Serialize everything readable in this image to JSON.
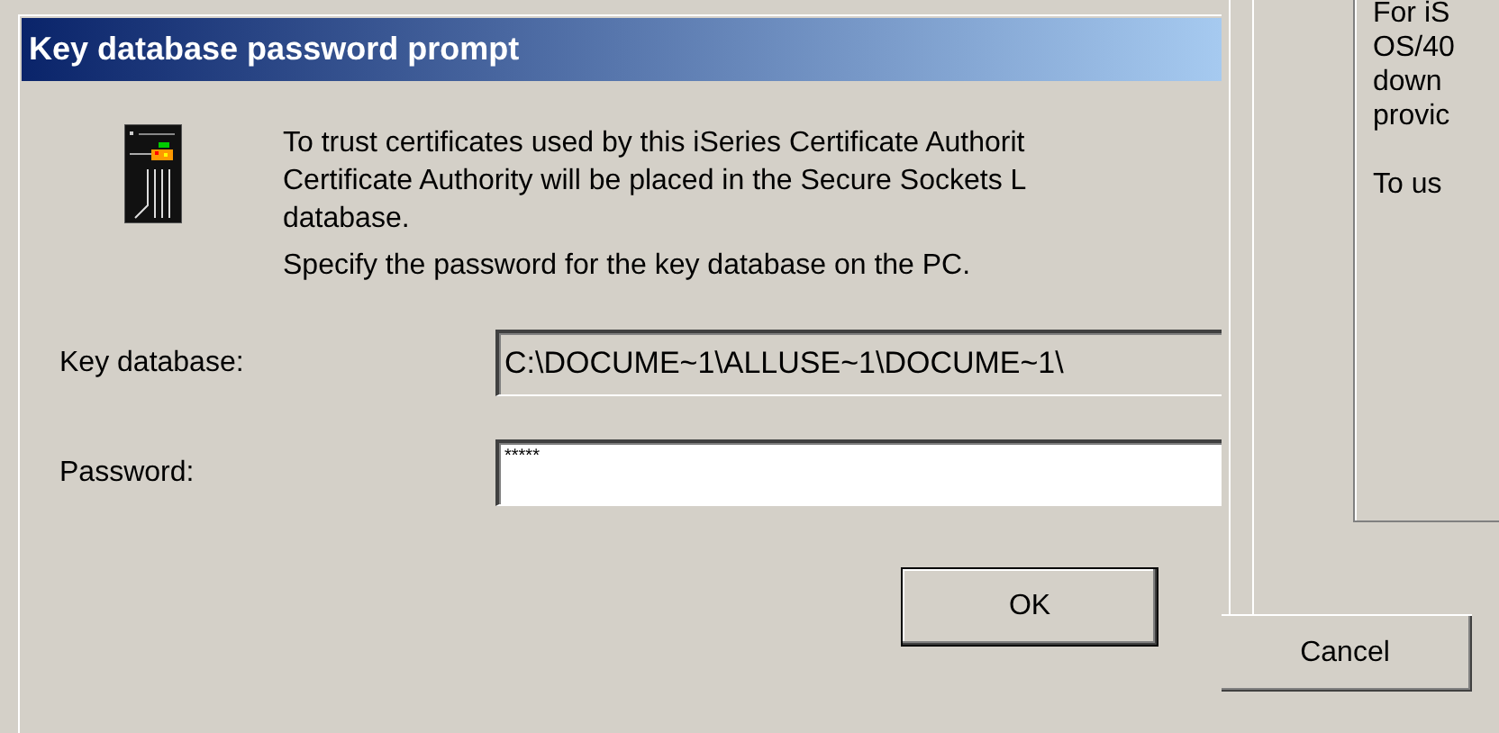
{
  "dialog": {
    "title": "Key database password prompt",
    "message_lines": [
      "To trust certificates used by this iSeries Certificate Authorit",
      "Certificate Authority will be placed in the Secure Sockets L",
      "database."
    ],
    "instruction": "Specify the password for the key database on the PC.",
    "fields": [
      {
        "label": "Key database:",
        "value": "C:\\DOCUME~1\\ALLUSE~1\\DOCUME~1\\",
        "disabled": true
      },
      {
        "label": "Password:",
        "value": "*****",
        "disabled": false
      }
    ],
    "buttons": [
      "OK"
    ]
  },
  "background_window": {
    "paragraphs": [
      [
        "For iS",
        "OS/40",
        "down",
        "provic"
      ],
      [
        "To us"
      ]
    ],
    "button": "Cancel"
  }
}
